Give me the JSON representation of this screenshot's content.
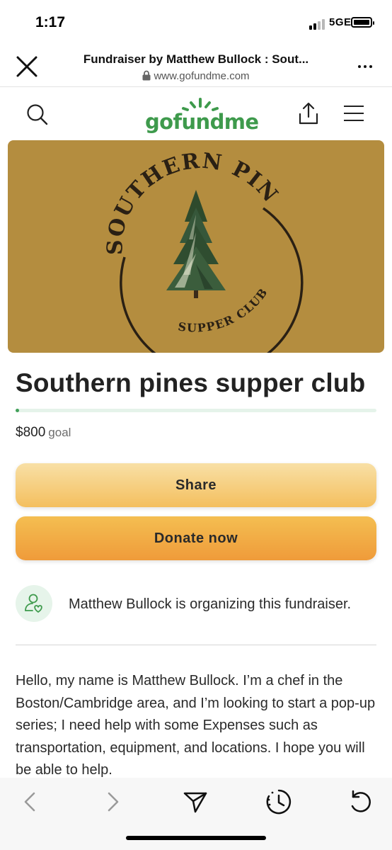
{
  "status_bar": {
    "time": "1:17",
    "network": "5GE"
  },
  "browser": {
    "title": "Fundraiser by Matthew Bullock : Sout...",
    "url": "www.gofundme.com"
  },
  "site": {
    "logo_text": "gofundme"
  },
  "hero": {
    "logo_top_text": "SOUTHERN PINES",
    "logo_bottom_text": "SUPPER CLUB"
  },
  "campaign": {
    "title": "Southern pines supper club",
    "amount": "$800",
    "goal_label": "goal",
    "progress_fraction": 0.01
  },
  "actions": {
    "share_label": "Share",
    "donate_label": "Donate now"
  },
  "organizer": {
    "text": "Matthew Bullock is organizing this fundraiser."
  },
  "story": {
    "text": "Hello, my name is Matthew Bullock. I’m a chef in the Boston/Cambridge area, and I’m looking to start a pop-up series; I need help with some Expenses such as transportation, equipment, and locations. I hope you will be able to help."
  },
  "colors": {
    "brand_green": "#3e9a4c",
    "hero_bg": "#b48d3f",
    "donate": "#f2ad45",
    "share": "#f7d690"
  },
  "icons": {
    "close": "close-icon",
    "more": "more-icon",
    "search": "search-icon",
    "share": "share-icon",
    "menu": "menu-icon",
    "organizer": "user-heart-icon",
    "back": "back-icon",
    "forward": "forward-icon",
    "send": "send-icon",
    "history": "history-icon",
    "reload": "reload-icon"
  }
}
